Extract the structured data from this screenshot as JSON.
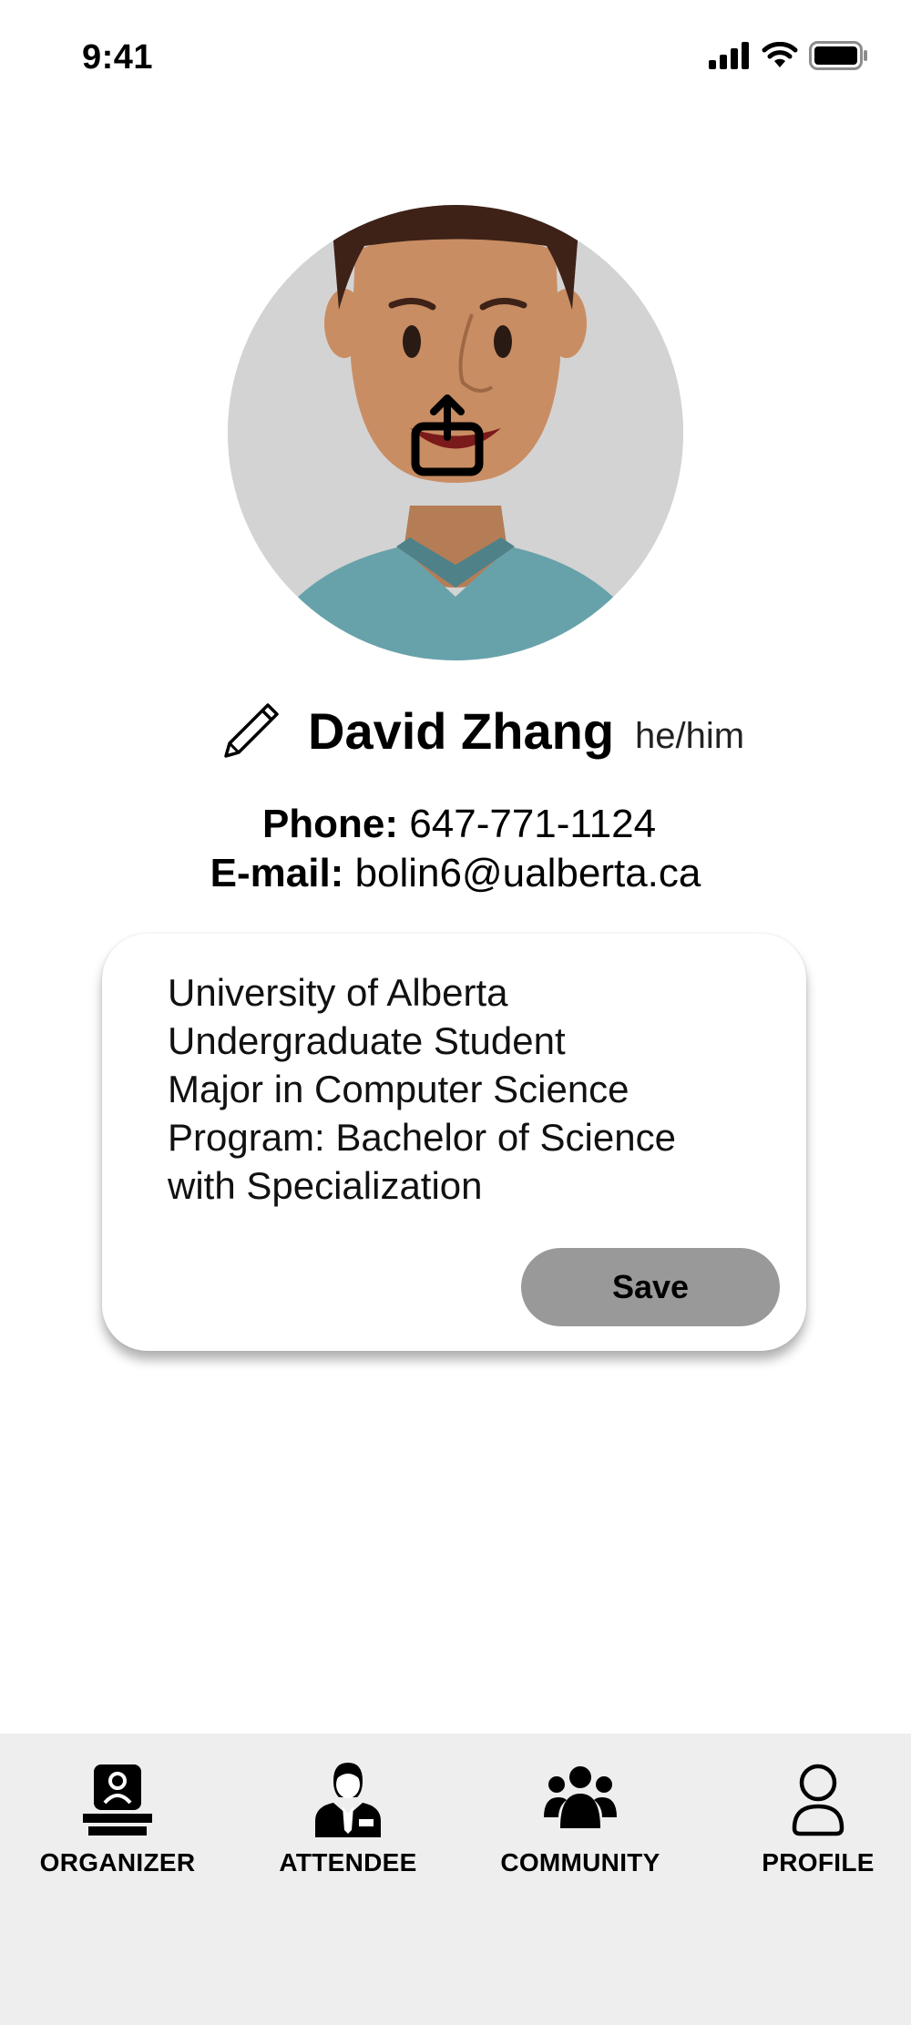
{
  "status_bar": {
    "time": "9:41"
  },
  "profile": {
    "name": "David Zhang",
    "pronouns": "he/him",
    "phone_label": "Phone:",
    "phone_value": "647-771-1124",
    "email_label": "E-mail:",
    "email_value": "bolin6@ualberta.ca"
  },
  "bio": {
    "lines": [
      "University of Alberta",
      "Undergraduate Student",
      "Major in Computer Science",
      "Program: Bachelor of Science",
      "with Specialization"
    ],
    "save_label": "Save"
  },
  "bottom_nav": {
    "items": [
      {
        "label": "ORGANIZER",
        "icon": "organizer-icon"
      },
      {
        "label": "ATTENDEE",
        "icon": "attendee-icon"
      },
      {
        "label": "COMMUNITY",
        "icon": "community-icon"
      },
      {
        "label": "PROFILE",
        "icon": "profile-icon"
      }
    ]
  },
  "colors": {
    "save_button": "#999999",
    "nav_background": "#eeeeee",
    "avatar_background": "#d3d3d3",
    "shirt": "#67a2ab"
  }
}
